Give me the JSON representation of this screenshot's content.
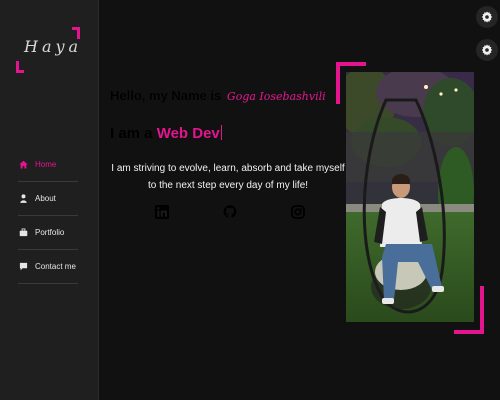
{
  "logo": {
    "text": "Haya"
  },
  "nav": {
    "items": [
      {
        "label": "Home",
        "icon": "home-icon",
        "active": true
      },
      {
        "label": "About",
        "icon": "person-icon",
        "active": false
      },
      {
        "label": "Portfolio",
        "icon": "briefcase-icon",
        "active": false
      },
      {
        "label": "Contact me",
        "icon": "chat-icon",
        "active": false
      }
    ]
  },
  "hero": {
    "greeting": "Hello, my Name is",
    "name": "Goga Iosebashvili",
    "role_prefix": "I am a",
    "role": "Web Dev",
    "tagline": "I am striving to evolve, learn, absorb and take myself to the next step every day of my life!"
  },
  "socials": [
    {
      "icon": "linkedin-icon"
    },
    {
      "icon": "github-icon"
    },
    {
      "icon": "instagram-icon"
    }
  ],
  "corner_buttons": [
    {
      "icon": "gear-icon"
    },
    {
      "icon": "gear-icon"
    }
  ],
  "colors": {
    "accent": "#e4148f",
    "sidebar_bg": "#1f1f1f",
    "main_bg": "#111111"
  }
}
